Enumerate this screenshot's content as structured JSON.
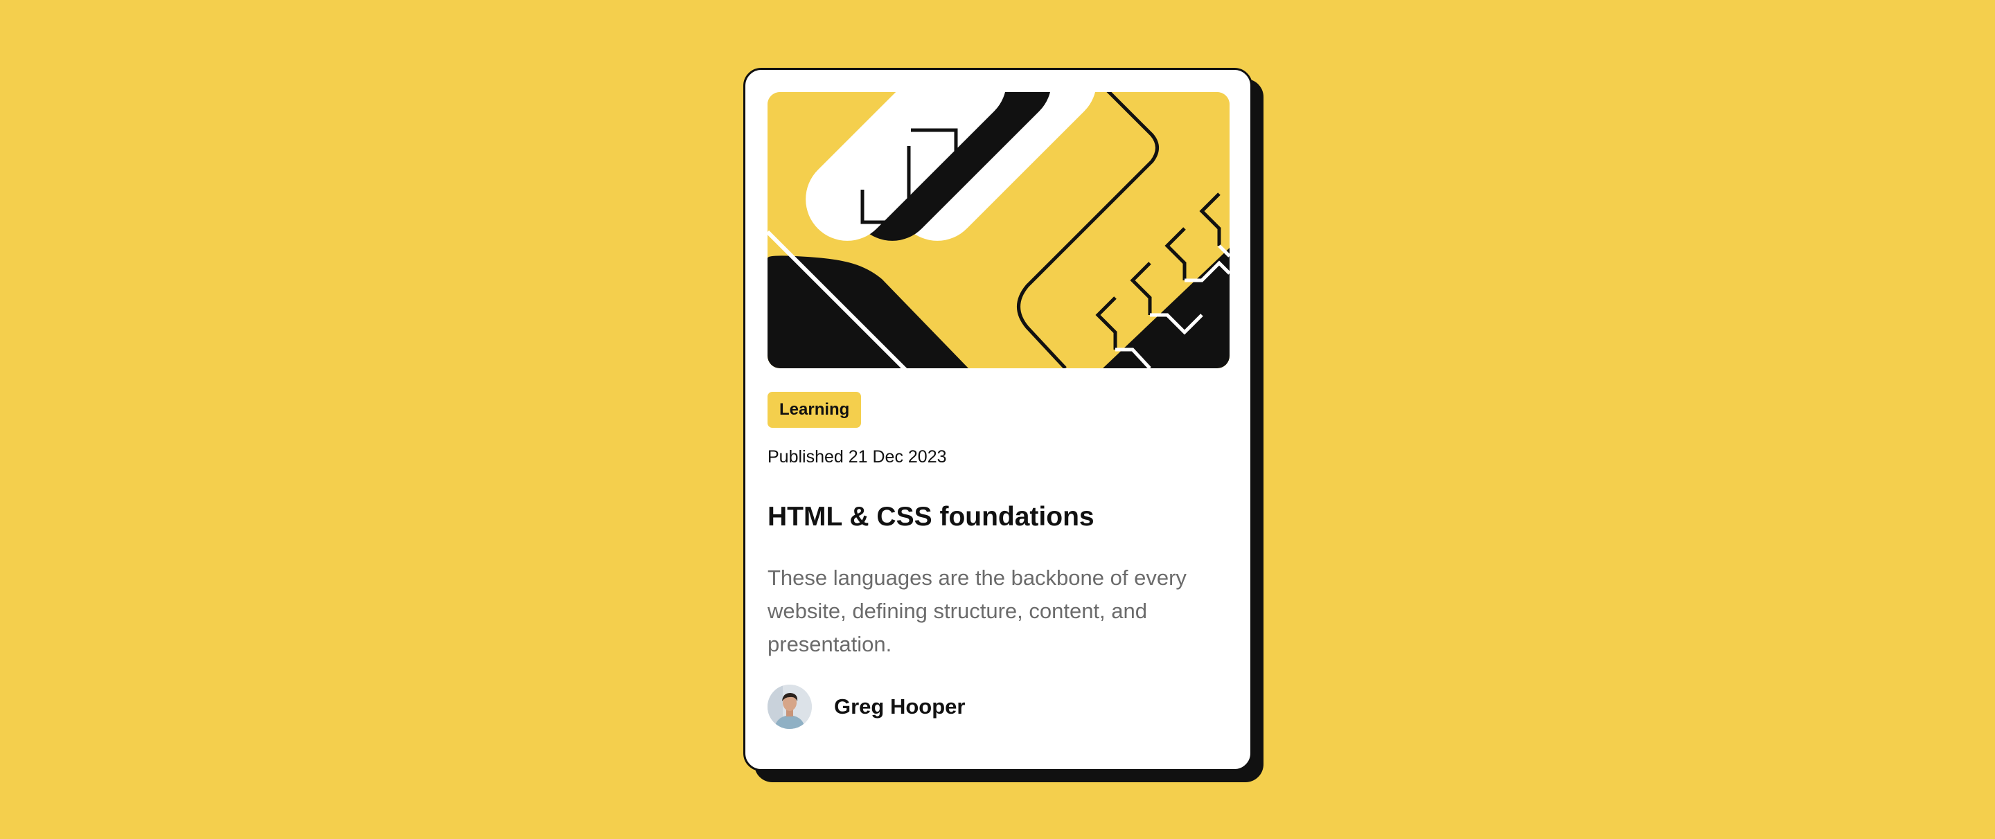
{
  "card": {
    "category": "Learning",
    "published": "Published 21 Dec 2023",
    "title": "HTML & CSS foundations",
    "description": "These languages are the backbone of every website, defining structure, content, and presentation.",
    "author": {
      "name": "Greg Hooper"
    }
  },
  "colors": {
    "background": "#F4CF4D",
    "card": "#FFFFFF",
    "ink": "#111111",
    "muted_text": "#6B6B6B"
  },
  "icons": {
    "hero": "abstract-illustration",
    "avatar": "author-photo"
  }
}
